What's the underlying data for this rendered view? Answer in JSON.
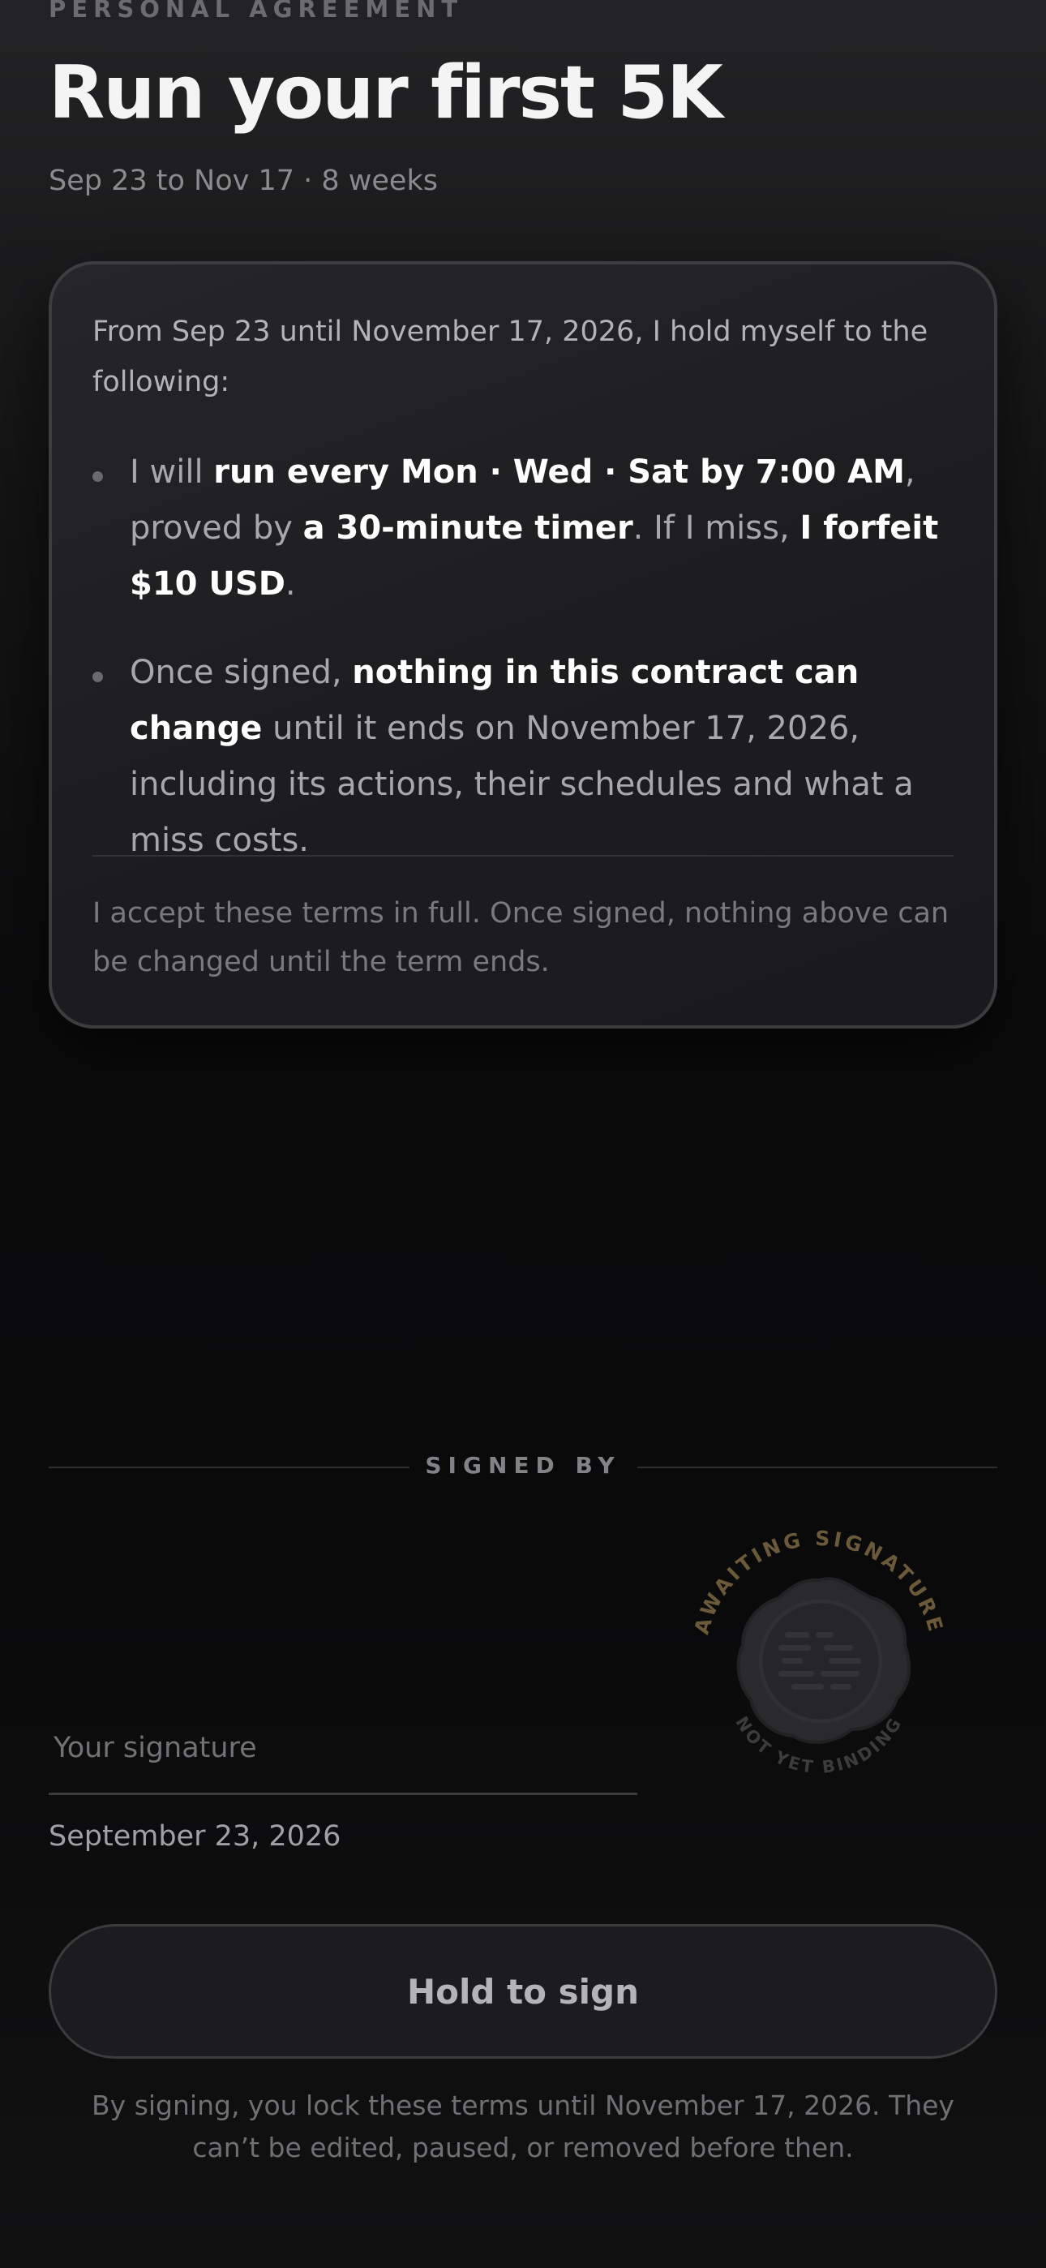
{
  "header": {
    "kicker": "PERSONAL AGREEMENT",
    "title": "Run your first 5K",
    "subtitle": "Sep 23 to Nov 17 · 8 weeks"
  },
  "contract": {
    "intro": "From Sep 23 until November 17, 2026, I hold myself to the following:",
    "bullet1": {
      "p1": "I will ",
      "b1": "run every Mon · Wed · Sat by 7:00 AM",
      "p2": ", proved by ",
      "b2": "a 30-minute timer",
      "p3": ". If I miss, ",
      "b3": "I forfeit $10 USD",
      "p4": "."
    },
    "bullet2": {
      "p1": "Once signed, ",
      "b1": "nothing in this contract can change",
      "p2": " until it ends on November 17, 2026, including its actions, their schedules and what a miss costs."
    },
    "acceptance": "I accept these terms in full. Once signed, nothing above can be changed until the term ends."
  },
  "signature": {
    "section_label": "SIGNED BY",
    "placeholder": "Your signature",
    "date": "September 23, 2026",
    "seal_top_text": "AWAITING SIGNATURE",
    "seal_bottom_text": "NOT YET BINDING",
    "seal_icon": "wax-seal-icon"
  },
  "actions": {
    "hold_label": "Hold to sign",
    "disclaimer": "By signing, you lock these terms until November 17, 2026. They can’t be edited, paused, or removed before then."
  },
  "colors": {
    "background": "#0b0b0c",
    "card": "#1f1f21",
    "seal_text": "#6b5a3a",
    "seal_wax": "#2a2a2c"
  }
}
